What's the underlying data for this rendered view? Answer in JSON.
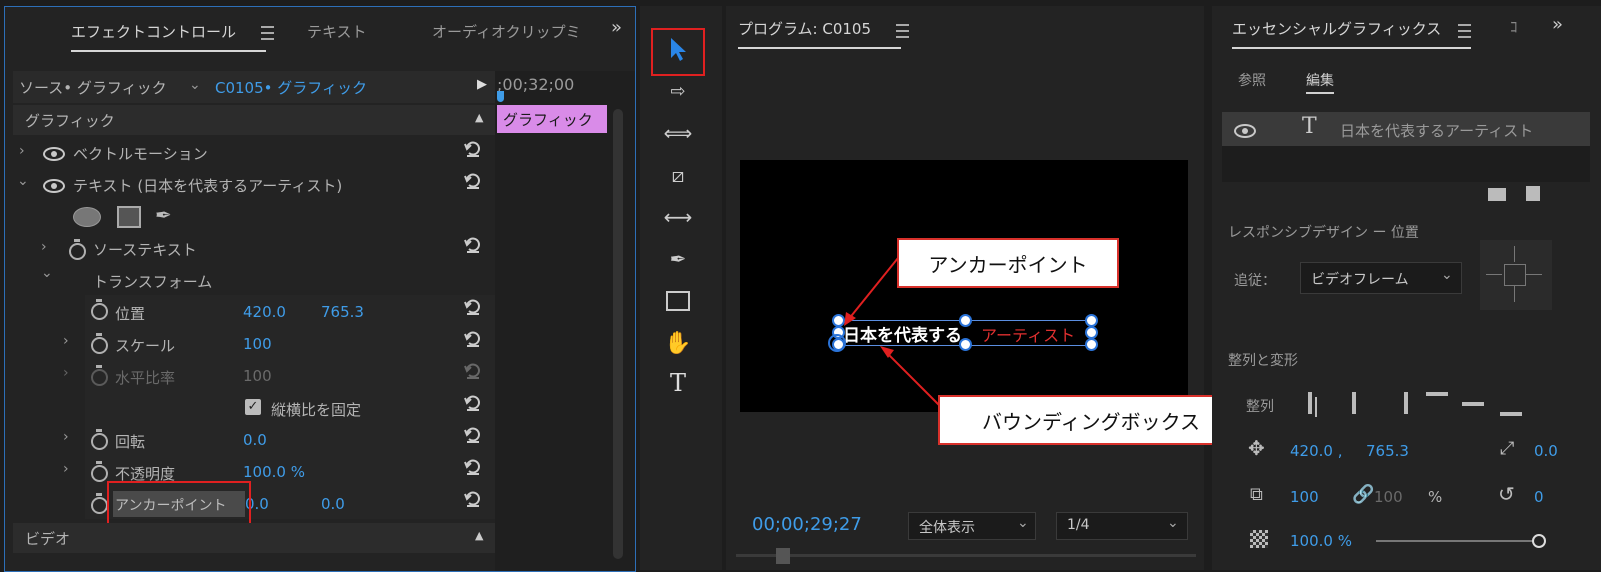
{
  "left_panel": {
    "tabs": [
      "エフェクトコントロール",
      "テキスト",
      "オーディオクリップミ"
    ],
    "source_label": "ソース• グラフィック",
    "clip_label": "C0105• グラフィック",
    "timecode": ";00;32;00",
    "clip_bar_label": "グラフィック",
    "section_graphic": "グラフィック",
    "section_video": "ビデオ",
    "vector_motion": "ベクトルモーション",
    "text_layer": "テキスト (日本を代表するアーティスト)",
    "source_text": "ソーステキスト",
    "transform": "トランスフォーム",
    "position": {
      "label": "位置",
      "x": "420.0",
      "y": "765.3"
    },
    "scale": {
      "label": "スケール",
      "value": "100"
    },
    "scale_width": {
      "label": "水平比率",
      "value": "100"
    },
    "uniform_scale": "縦横比を固定",
    "rotation": {
      "label": "回転",
      "value": "0.0"
    },
    "opacity": {
      "label": "不透明度",
      "value": "100.0 %"
    },
    "anchor": {
      "label": "アンカーポイント",
      "x": "0.0",
      "y": "0.0"
    }
  },
  "program": {
    "title": "プログラム: C0105",
    "timecode": "00;00;29;27",
    "zoom": "全体表示",
    "resolution": "1/4",
    "text_white": "日本を代表する",
    "text_red": "アーティスト",
    "callout_anchor": "アンカーポイント",
    "callout_bbox": "バウンディングボックス"
  },
  "essential": {
    "title": "エッセンシャルグラフィックス",
    "tab_browse": "参照",
    "tab_edit": "編集",
    "layer_name": "日本を代表するアーティスト",
    "responsive_label": "レスポンシブデザイン ー 位置",
    "follow_label": "追従：",
    "follow_value": "ビデオフレーム",
    "align_section": "整列と変形",
    "align_label": "整列",
    "pos_x": "420.0 ,",
    "pos_y": "765.3",
    "anchor_val": "0.0",
    "scale_val": "100",
    "scale2_val": "100",
    "percent": "%",
    "rotation_val": "0",
    "opacity_val": "100.0 %"
  },
  "colors": {
    "accent_blue": "#3f9ce8",
    "highlight_red": "#e02020",
    "clip_purple": "#d98be8"
  }
}
